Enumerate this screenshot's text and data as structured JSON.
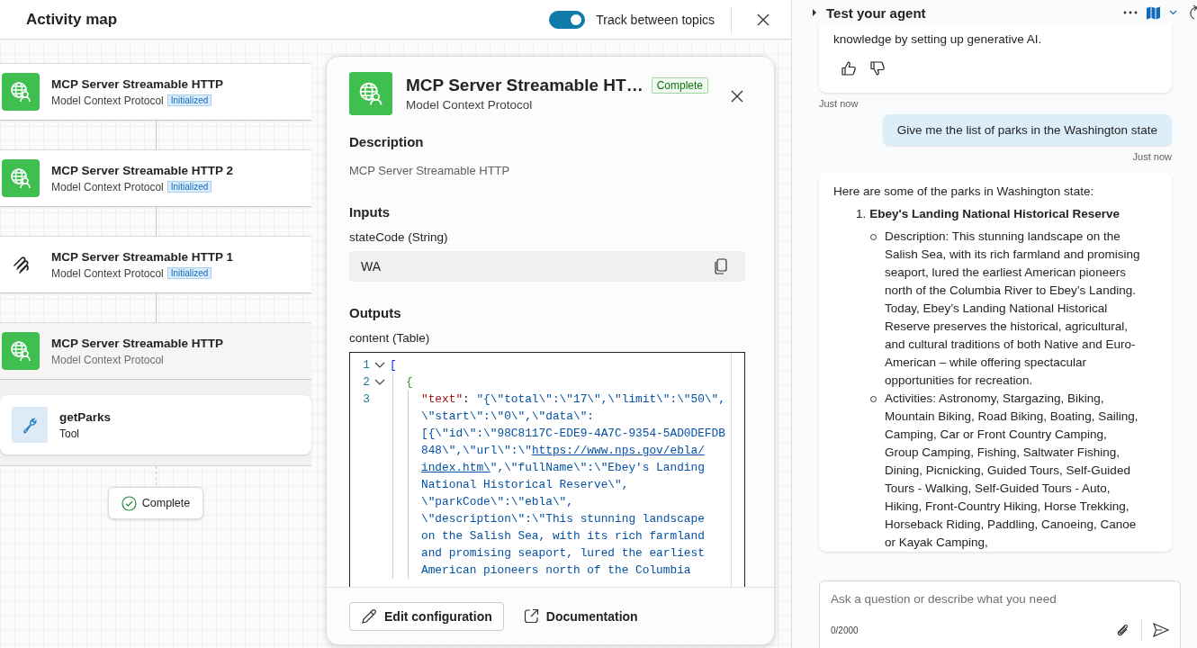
{
  "activity_map": {
    "title": "Activity map",
    "track_toggle": {
      "label": "Track between topics",
      "on": true
    }
  },
  "nodes": [
    {
      "kind": "globe",
      "title": "MCP Server Streamable HTTP",
      "subtitle": "Model Context Protocol",
      "badge": "Initialized",
      "selected": false
    },
    {
      "kind": "globe",
      "title": "MCP Server Streamable HTTP 2",
      "subtitle": "Model Context Protocol",
      "badge": "Initialized",
      "selected": false
    },
    {
      "kind": "mcp",
      "title": "MCP Server Streamable HTTP 1",
      "subtitle": "Model Context Protocol",
      "badge": "Initialized",
      "selected": false
    },
    {
      "kind": "globe",
      "title": "MCP Server Streamable HTTP",
      "subtitle": "Model Context Protocol",
      "selected": true
    }
  ],
  "tool_node": {
    "title": "getParks",
    "subtitle": "Tool"
  },
  "end_pill": "Complete",
  "details": {
    "title": "MCP Server Streamable HT…",
    "status": "Complete",
    "subtitle": "Model Context Protocol",
    "description_heading": "Description",
    "description": "MCP Server Streamable HTTP",
    "inputs_heading": "Inputs",
    "input_label": "stateCode (String)",
    "input_value": "WA",
    "outputs_heading": "Outputs",
    "output_label": "content (Table)",
    "code": [
      {
        "number": "1",
        "expanded": true,
        "kind": "array_open",
        "parts": [
          {
            "kind": "bracket",
            "text": "["
          }
        ]
      },
      {
        "number": "2",
        "expanded": true,
        "kind": "object_open",
        "parts": [
          {
            "kind": "brace",
            "text": "{"
          }
        ]
      },
      {
        "number": "3",
        "kind": "member",
        "parts": [
          {
            "kind": "key",
            "text": "\"text\""
          },
          {
            "kind": "punct",
            "text": ": "
          },
          {
            "kind": "string",
            "text": "\"{\\\"total\\\":\\\"17\\\",\\\"limit\\\":\\\"50\\\","
          }
        ]
      },
      {
        "kind": "member",
        "parts": [
          {
            "kind": "string",
            "text": "\\\"start\\\":\\\"0\\\",\\\"data\\\":"
          }
        ]
      },
      {
        "kind": "member",
        "parts": [
          {
            "kind": "string",
            "text": "[{\\\"id\\\":\\\"98C8117C-EDE9-4A7C-9354-5AD0DEFDB"
          }
        ]
      },
      {
        "kind": "member",
        "parts": [
          {
            "kind": "string",
            "text": "848\\\",\\\"url\\\":\\\""
          },
          {
            "kind": "link",
            "text": "https://www.nps.gov/ebla/"
          }
        ]
      },
      {
        "kind": "member",
        "parts": [
          {
            "kind": "link",
            "text": "index.htm\\"
          },
          {
            "kind": "string",
            "text": "\",\\\"fullName\\\":\\\"Ebey's Landing"
          }
        ]
      },
      {
        "kind": "member",
        "parts": [
          {
            "kind": "string",
            "text": "National Historical Reserve\\\","
          }
        ]
      },
      {
        "kind": "member",
        "parts": [
          {
            "kind": "string",
            "text": "\\\"parkCode\\\":\\\"ebla\\\","
          }
        ]
      },
      {
        "kind": "member",
        "parts": [
          {
            "kind": "string",
            "text": "\\\"description\\\":\\\"This stunning landscape"
          }
        ]
      },
      {
        "kind": "member",
        "parts": [
          {
            "kind": "string",
            "text": "on the Salish Sea, with its rich farmland"
          }
        ]
      },
      {
        "kind": "member",
        "parts": [
          {
            "kind": "string",
            "text": "and promising seaport, lured the earliest"
          }
        ]
      },
      {
        "kind": "member",
        "parts": [
          {
            "kind": "string",
            "text": "American pioneers north of the Columbia"
          }
        ]
      }
    ],
    "buttons": [
      {
        "kind": "edit",
        "label": "Edit configuration"
      },
      {
        "kind": "link",
        "label": "Documentation"
      }
    ]
  },
  "chat": {
    "title": "Test your agent",
    "messages": [
      {
        "kind": "bot",
        "text": "knowledge by setting up generative AI.",
        "feedback": true,
        "time": "Just now"
      },
      {
        "kind": "user",
        "text": "Give me the list of parks in the Washington state",
        "time": "Just now"
      },
      {
        "kind": "bot_list",
        "intro": "Here are some of the parks in Washington state:",
        "items": [
          {
            "number": "1.",
            "title": "Ebey's Landing National Historical Reserve",
            "bullets": [
              "Description: This stunning landscape on the Salish Sea, with its rich farmland and promising seaport, lured the earliest American pioneers north of the Columbia River to Ebey’s Landing. Today, Ebey’s Landing National Historical Reserve preserves the historical, agricultural, and cultural traditions of both Native and Euro-American – while offering spectacular opportunities for recreation.",
              "Activities: Astronomy, Stargazing, Biking, Mountain Biking, Road Biking, Boating, Sailing, Camping, Car or Front Country Camping, Group Camping, Fishing, Saltwater Fishing, Dining, Picnicking, Guided Tours, Self-Guided Tours - Walking, Self-Guided Tours - Auto, Hiking, Front-Country Hiking, Horse Trekking, Horseback Riding, Paddling, Canoeing, Canoe or Kayak Camping,"
            ]
          }
        ]
      }
    ],
    "input": {
      "placeholder": "Ask a question or describe what you need",
      "counter": "0/2000"
    }
  }
}
